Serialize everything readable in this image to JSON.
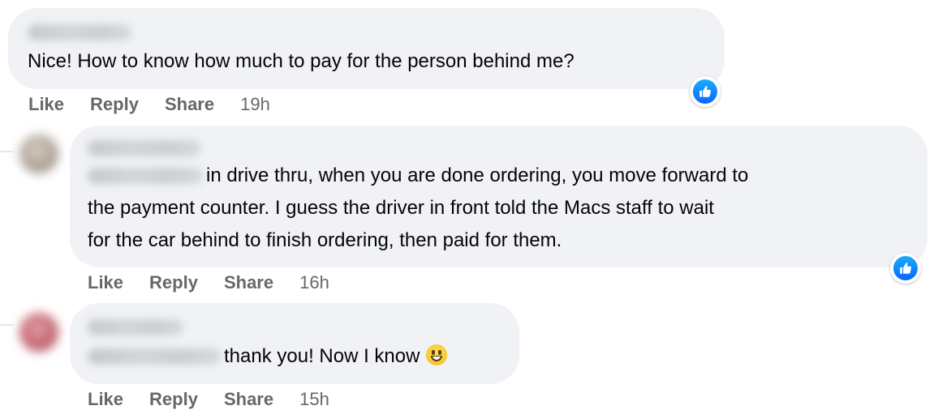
{
  "comments": [
    {
      "text": "Nice! How to know how much to pay for the person behind me?",
      "actions": {
        "like": "Like",
        "reply": "Reply",
        "share": "Share",
        "time": "19h"
      }
    },
    {
      "lines": [
        "in drive thru, when you are done ordering, you move forward to",
        "the payment counter. I guess the driver in front told the Macs staff to wait",
        "for the car behind to finish ordering, then paid for them."
      ],
      "actions": {
        "like": "Like",
        "reply": "Reply",
        "share": "Share",
        "time": "16h"
      }
    },
    {
      "text": "thank you! Now I know",
      "emoji": "grinning-face-emoji",
      "actions": {
        "like": "Like",
        "reply": "Reply",
        "share": "Share",
        "time": "15h"
      }
    }
  ],
  "icons": {
    "reaction": "thumbs-up-icon"
  },
  "colors": {
    "bubble": "#f0f2f5",
    "like_blue": "#0866ff",
    "action_gray": "#65676b"
  }
}
